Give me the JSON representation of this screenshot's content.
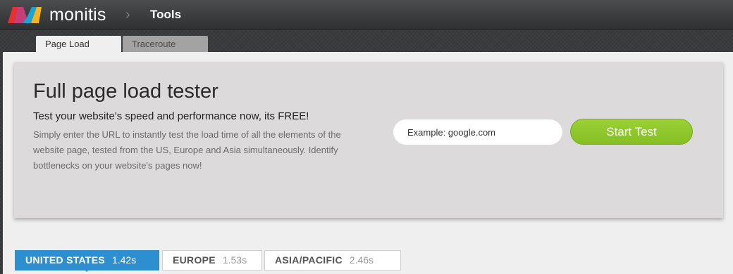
{
  "brand": {
    "name": "monitis"
  },
  "breadcrumb": {
    "separator": "›",
    "current": "Tools"
  },
  "tabs": [
    {
      "label": "Page Load",
      "active": true
    },
    {
      "label": "Traceroute",
      "active": false
    }
  ],
  "hero": {
    "title": "Full page load tester",
    "subtitle": "Test your website's speed and performance now, its FREE!",
    "description": "Simply enter the URL to instantly test the load time of all the elements of the website page, tested from the US, Europe and Asia simultaneously. Identify bottlenecks on your website's pages now!",
    "url_placeholder": "Example: google.com",
    "start_label": "Start Test"
  },
  "regions": [
    {
      "name": "UNITED STATES",
      "time": "1.42s",
      "active": true
    },
    {
      "name": "EUROPE",
      "time": "1.53s",
      "active": false
    },
    {
      "name": "ASIA/PACIFIC",
      "time": "2.46s",
      "active": false
    }
  ],
  "colors": {
    "accent_blue": "#2d8fd0",
    "start_green": "#8cc72a",
    "logo": [
      "#e8312c",
      "#f6b51f",
      "#19a3d9",
      "#c0392b"
    ]
  }
}
